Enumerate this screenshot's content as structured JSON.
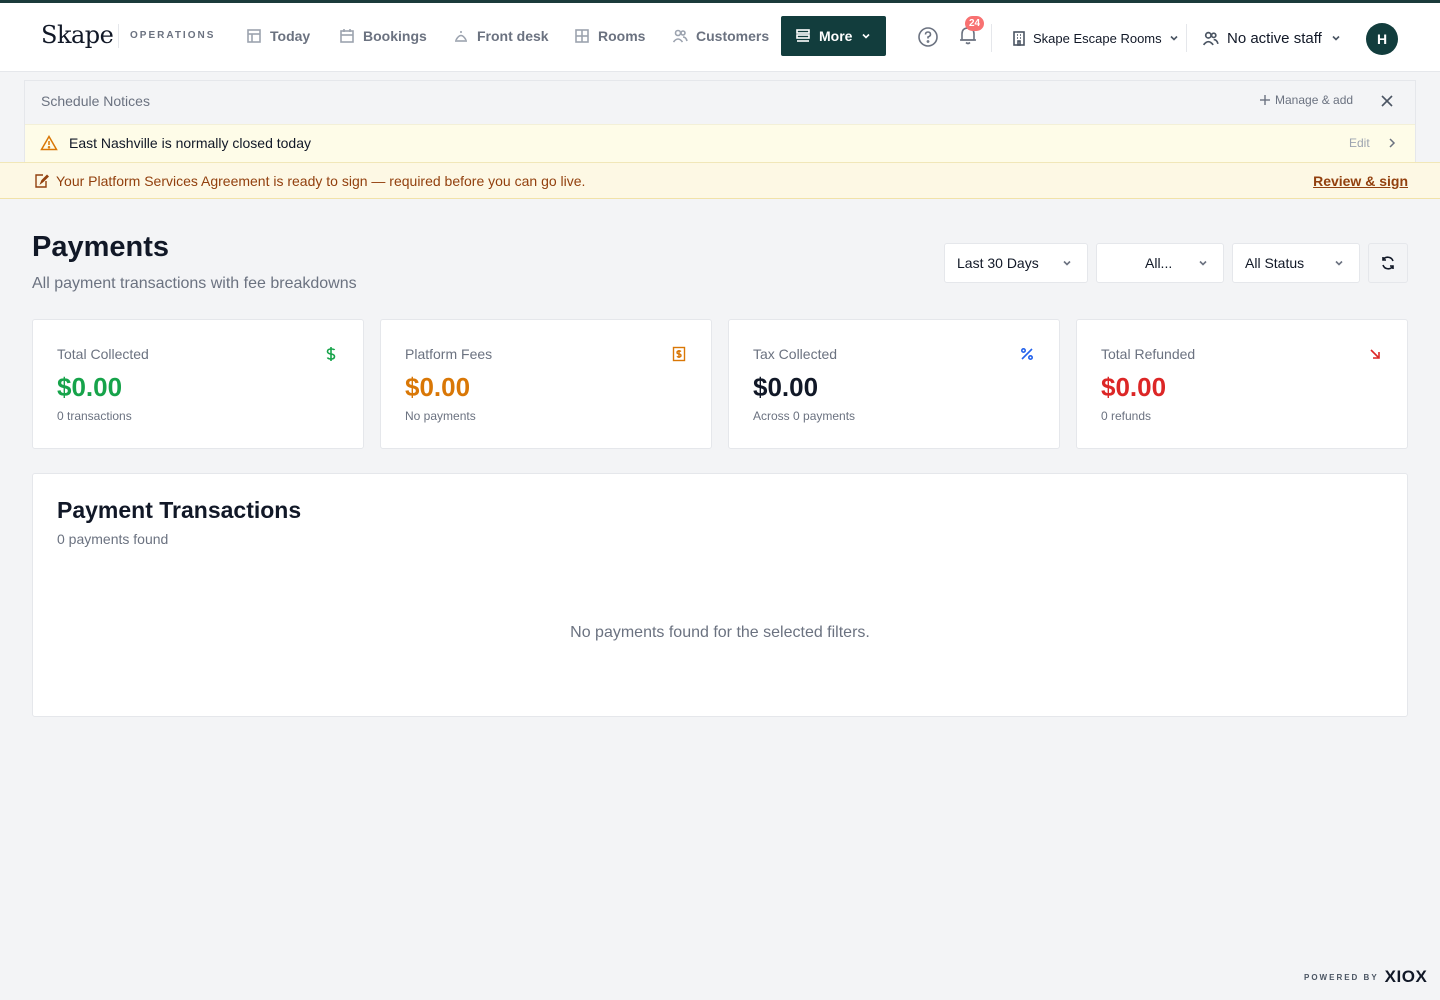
{
  "header": {
    "logo": "Skape",
    "section_label": "OPERATIONS",
    "nav": [
      {
        "label": "Today",
        "icon": "table-icon"
      },
      {
        "label": "Bookings",
        "icon": "calendar-icon"
      },
      {
        "label": "Front desk",
        "icon": "bell-desk-icon"
      },
      {
        "label": "Rooms",
        "icon": "grid-icon"
      },
      {
        "label": "Customers",
        "icon": "users-icon"
      }
    ],
    "more_label": "More",
    "notification_count": "24",
    "company": "Skape Escape Rooms",
    "staff": "No active staff",
    "avatar_initial": "H"
  },
  "notices": {
    "title": "Schedule Notices",
    "manage_label": "Manage & add",
    "items": [
      {
        "text": "East Nashville is normally closed today",
        "action": "Edit"
      }
    ]
  },
  "agreement": {
    "text": "Your Platform Services Agreement is ready to sign — required before you can go live.",
    "link": "Review & sign"
  },
  "page": {
    "title": "Payments",
    "subtitle": "All payment transactions with fee breakdowns",
    "filters": {
      "range": "Last 30 Days",
      "location": "All...",
      "status": "All Status"
    }
  },
  "stats": [
    {
      "label": "Total Collected",
      "value": "$0.00",
      "foot": "0 transactions",
      "color": "#16a34a",
      "icon": "dollar-icon"
    },
    {
      "label": "Platform Fees",
      "value": "$0.00",
      "foot": "No payments",
      "color": "#d97706",
      "icon": "receipt-icon"
    },
    {
      "label": "Tax Collected",
      "value": "$0.00",
      "foot": "Across 0 payments",
      "color": "#111827",
      "icon": "percent-icon"
    },
    {
      "label": "Total Refunded",
      "value": "$0.00",
      "foot": "0 refunds",
      "color": "#dc2626",
      "icon": "arrow-down-right-icon"
    }
  ],
  "transactions": {
    "title": "Payment Transactions",
    "count_text": "0 payments found",
    "empty_text": "No payments found for the selected filters."
  },
  "footer": {
    "powered_by": "POWERED BY",
    "brand": "XIOX"
  }
}
